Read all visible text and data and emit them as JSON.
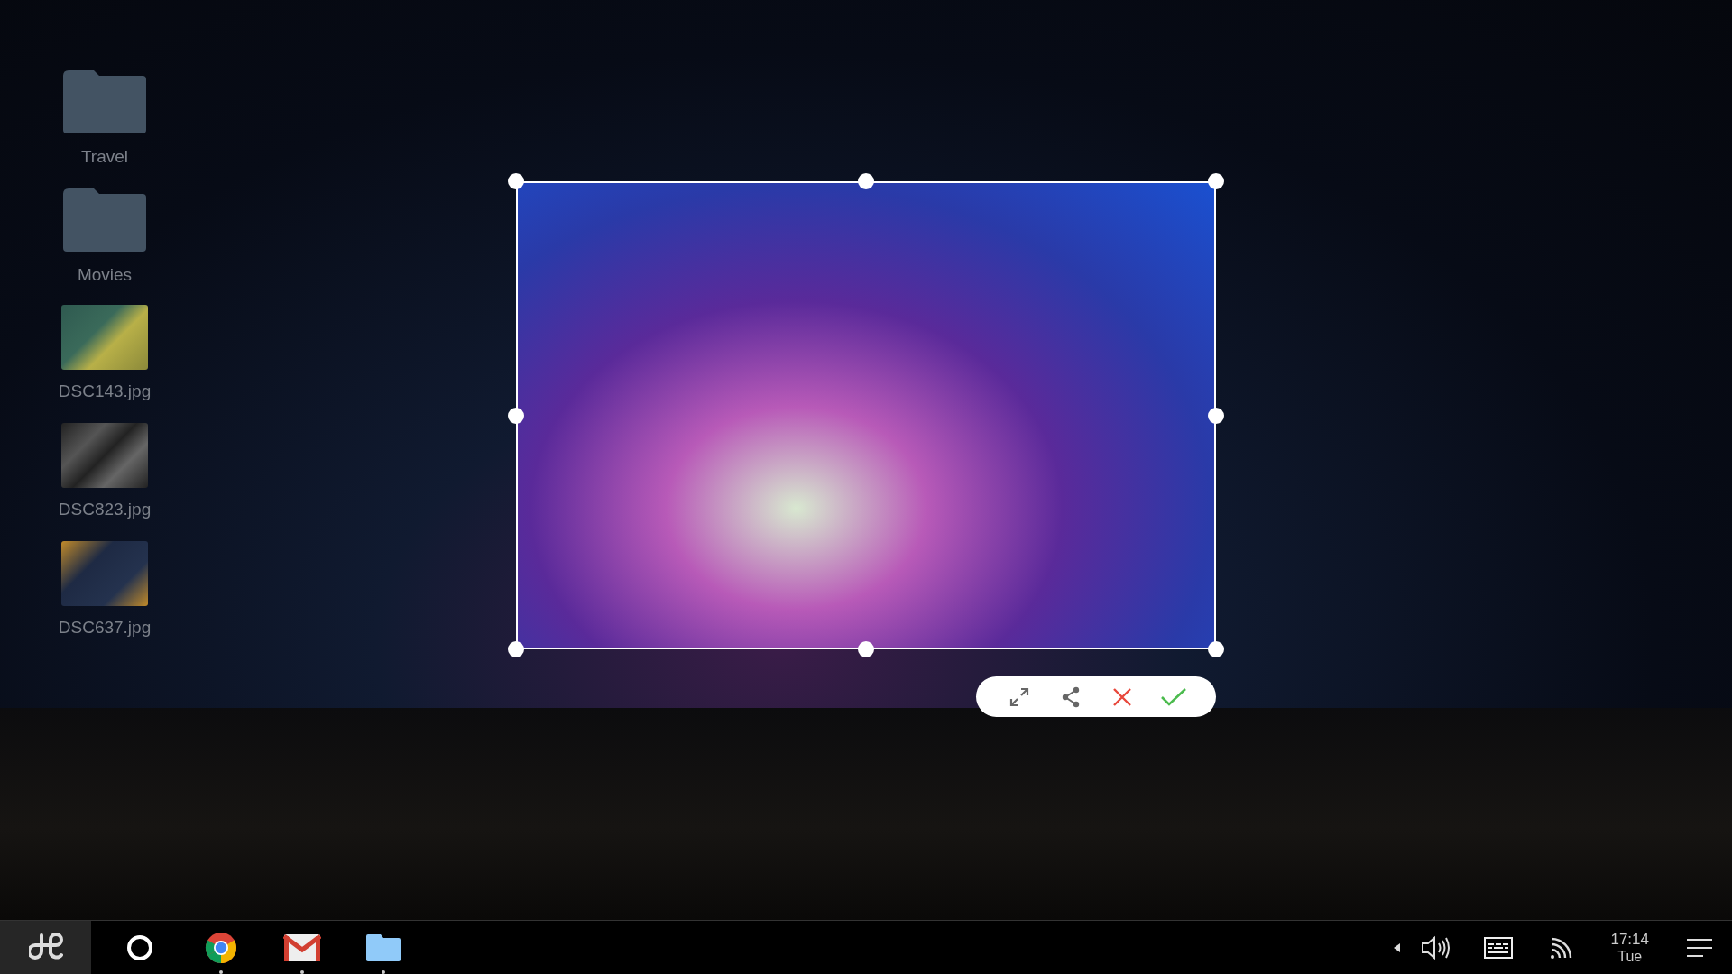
{
  "desktop_icons": [
    {
      "label": "Travel",
      "kind": "folder"
    },
    {
      "label": "Movies",
      "kind": "folder"
    },
    {
      "label": "DSC143.jpg",
      "kind": "image"
    },
    {
      "label": "DSC823.jpg",
      "kind": "image"
    },
    {
      "label": "DSC637.jpg",
      "kind": "image"
    }
  ],
  "crop_toolbar": [
    {
      "kind": "expand"
    },
    {
      "kind": "share"
    },
    {
      "kind": "cancel"
    },
    {
      "kind": "confirm"
    }
  ],
  "taskbar": {
    "apps": [
      {
        "kind": "launcher",
        "running": false
      },
      {
        "kind": "chrome",
        "running": true
      },
      {
        "kind": "gmail",
        "running": true
      },
      {
        "kind": "files",
        "running": true
      }
    ],
    "time": "17:14",
    "day": "Tue"
  }
}
